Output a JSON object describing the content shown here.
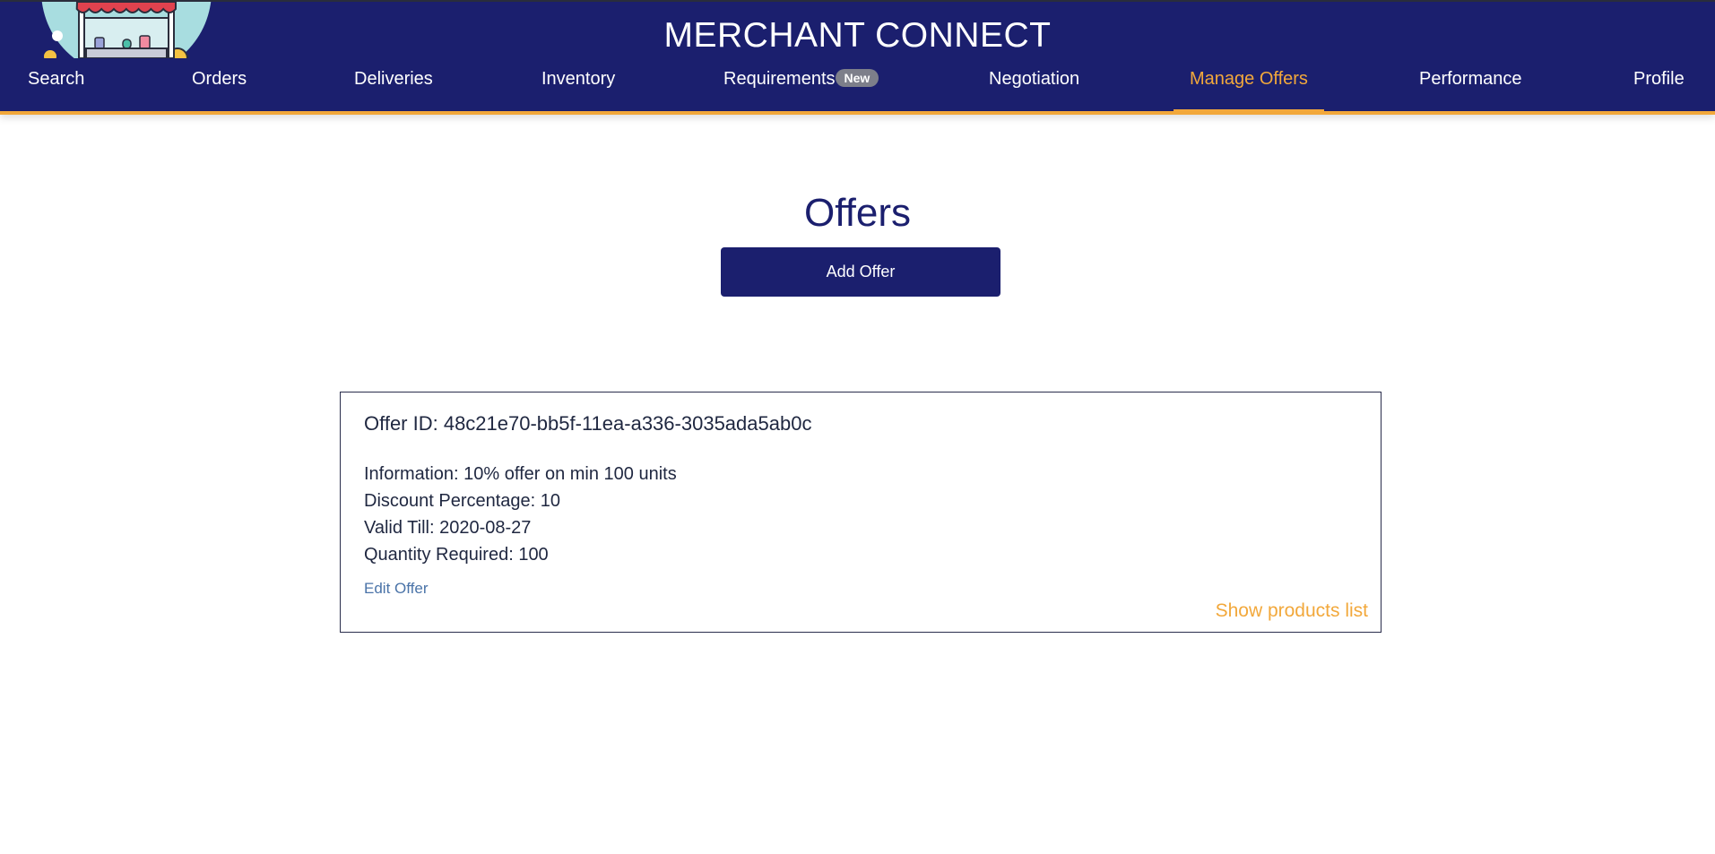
{
  "app": {
    "title": "MERCHANT CONNECT"
  },
  "colors": {
    "header_bg": "#1b1f6e",
    "accent": "#f2a83b",
    "link": "#4a73a8",
    "badge_bg": "#7d7f8a"
  },
  "nav": {
    "items": [
      {
        "label": "Search"
      },
      {
        "label": "Orders"
      },
      {
        "label": "Deliveries"
      },
      {
        "label": "Inventory"
      },
      {
        "label": "Requirements",
        "badge": "New"
      },
      {
        "label": "Negotiation"
      },
      {
        "label": "Manage Offers",
        "active": true
      },
      {
        "label": "Performance"
      },
      {
        "label": "Profile"
      }
    ]
  },
  "page": {
    "title": "Offers",
    "add_button": "Add Offer"
  },
  "offer": {
    "id_label": "Offer ID: 48c21e70-bb5f-11ea-a336-3035ada5ab0c",
    "information": "Information: 10% offer on min 100 units",
    "discount": "Discount Percentage: 10",
    "valid_till": "Valid Till: 2020-08-27",
    "quantity": "Quantity Required: 100",
    "edit_link": "Edit Offer",
    "products_link": "Show products list"
  }
}
